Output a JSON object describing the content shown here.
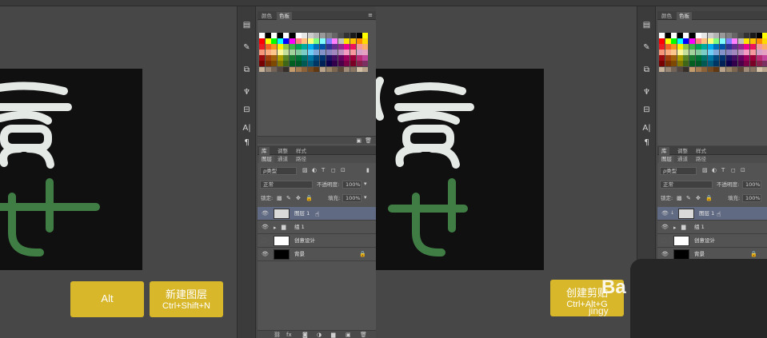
{
  "palette": {
    "rows": [
      [
        "#ffffff",
        "#000000",
        "#ffffff",
        "#000000",
        "#ffffff",
        "#000000",
        "#ffffff",
        "#e6e6e6",
        "#cccccc",
        "#b3b3b3",
        "#999999",
        "#808080",
        "#666666",
        "#4d4d4d",
        "#333333",
        "#1a1a1a",
        "#000000",
        "#ffff00"
      ],
      [
        "#ff0000",
        "#ffff00",
        "#00ff00",
        "#00ffff",
        "#0000ff",
        "#ff00ff",
        "#ff7f7f",
        "#ffbf7f",
        "#ffff7f",
        "#7fff7f",
        "#7fffff",
        "#7f7fff",
        "#ff7fff",
        "#c0c0c0",
        "#ffe400",
        "#ffc000",
        "#ff8c00",
        "#ffd800"
      ],
      [
        "#ed1c24",
        "#f26522",
        "#f7941d",
        "#fff200",
        "#8dc63f",
        "#39b54a",
        "#00a651",
        "#00a99d",
        "#00aeef",
        "#0072bc",
        "#0054a6",
        "#2e3192",
        "#662d91",
        "#92278f",
        "#ec008c",
        "#ed145b",
        "#f5989d",
        "#fbad6b"
      ],
      [
        "#f7977a",
        "#f9ad81",
        "#fdc68a",
        "#fff79a",
        "#c4df9b",
        "#a2d39c",
        "#82ca9d",
        "#7bcdc8",
        "#6ecff6",
        "#7ea7d8",
        "#8493ca",
        "#8882be",
        "#a187be",
        "#bc8dbf",
        "#f49ac2",
        "#f6989d",
        "#d6a1c8",
        "#e6a0c0"
      ],
      [
        "#9e0b0f",
        "#a0410d",
        "#a3620a",
        "#aba000",
        "#598527",
        "#197b30",
        "#007236",
        "#00746b",
        "#0076a3",
        "#004a80",
        "#003471",
        "#1b1464",
        "#440e62",
        "#630460",
        "#9e005d",
        "#9e0039",
        "#b72c72",
        "#c1469c"
      ],
      [
        "#790000",
        "#7b2e00",
        "#7d4900",
        "#827b00",
        "#406618",
        "#005e20",
        "#005826",
        "#005952",
        "#005b7f",
        "#003663",
        "#002157",
        "#0d004c",
        "#32004b",
        "#4b0049",
        "#7b0046",
        "#7a0026",
        "#8a1f4c",
        "#7a3060"
      ],
      [
        "#c7b299",
        "#998675",
        "#736357",
        "#534741",
        "#37302a",
        "#c69c6d",
        "#a67c52",
        "#8c6239",
        "#754c24",
        "#603913",
        "#b9a38a",
        "#9b8568",
        "#7c6650",
        "#5e4a3a",
        "#9f8b78",
        "#8a7563",
        "#d4c0a5",
        "#b8a48c"
      ]
    ]
  },
  "swatches_panel": {
    "tabs": [
      "颜色",
      "色板"
    ]
  },
  "layers_panel": {
    "tabs": [
      "库",
      "调整",
      "样式"
    ],
    "subtabs": [
      "图层",
      "通道",
      "路径"
    ],
    "filter_kind": "ρ类型",
    "blend_mode": "正常",
    "opacity_label": "不透明度:",
    "opacity_value": "100%",
    "lock_label": "锁定:",
    "fill_label": "填充:",
    "fill_value": "100%",
    "layers": [
      {
        "name": "图层 1",
        "selected": true,
        "thumb": "#d9d9d9"
      },
      {
        "name": "组 1",
        "selected": false,
        "thumb": "folder"
      },
      {
        "name": "创意设计",
        "selected": false,
        "thumb": "#ffffff"
      },
      {
        "name": "背景",
        "selected": false,
        "thumb": "#000000",
        "locked": true
      }
    ]
  },
  "left_keycaps": {
    "alt": "Alt",
    "new_layer_line1": "新建图层",
    "new_layer_line2": "Ctrl+Shift+N"
  },
  "right_keycaps": {
    "clip_line1": "创建剪贴",
    "clip_line2": "Ctrl+Alt+G"
  },
  "watermark": {
    "brand": "Ba",
    "sub": "jingy"
  },
  "colors": {
    "keycap": "#d8b72b",
    "canvas_bg": "#101010",
    "artwork_white": "#e5e9e6",
    "artwork_green": "#3f7d45",
    "selected_layer": "#606a82"
  }
}
